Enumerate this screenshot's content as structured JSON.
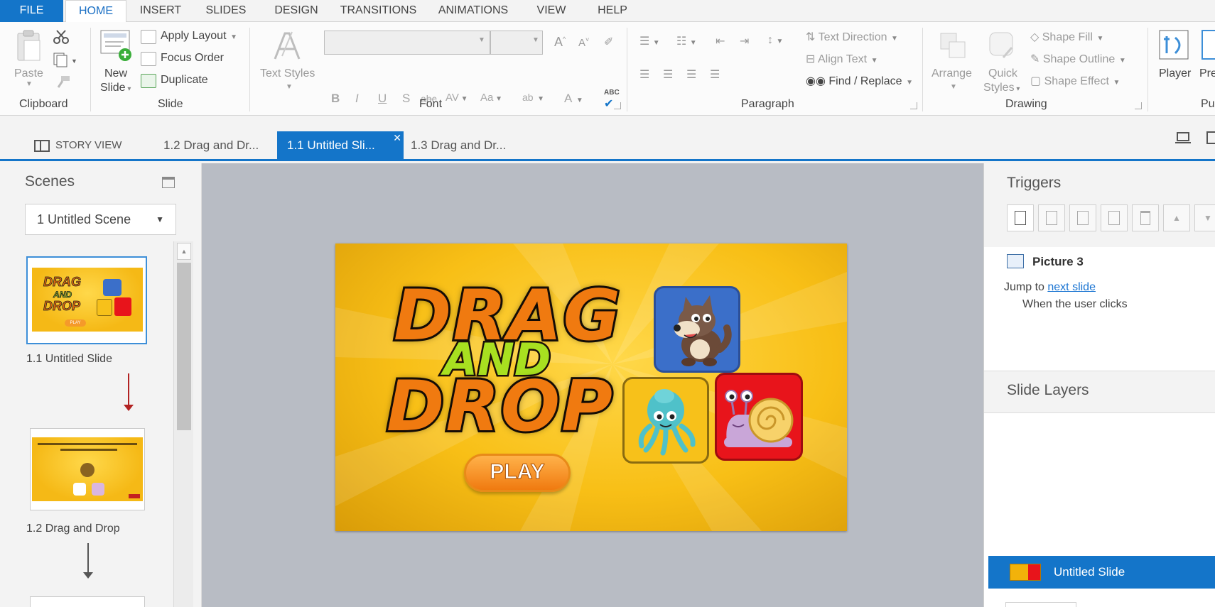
{
  "menu": [
    "FILE",
    "HOME",
    "INSERT",
    "SLIDES",
    "DESIGN",
    "TRANSITIONS",
    "ANIMATIONS",
    "VIEW",
    "HELP"
  ],
  "ribbon": {
    "clipboard": {
      "paste": "Paste",
      "label": "Clipboard"
    },
    "slide": {
      "new_slide_line1": "New",
      "new_slide_line2": "Slide",
      "apply_layout": "Apply Layout",
      "focus_order": "Focus Order",
      "duplicate": "Duplicate",
      "label": "Slide"
    },
    "text_styles": "Text Styles",
    "font": {
      "label": "Font",
      "bold": "B",
      "italic": "I",
      "underline": "U",
      "shadow": "S",
      "strike": "abc",
      "spacing": "AV",
      "case": "Aa",
      "highlight": "ab",
      "color": "A",
      "spell": "ABC"
    },
    "paragraph": {
      "text_direction": "Text Direction",
      "align_text": "Align Text",
      "find_replace": "Find / Replace",
      "label": "Paragraph"
    },
    "drawing": {
      "arrange": "Arrange",
      "quick_line1": "Quick",
      "quick_line2": "Styles",
      "shape_fill": "Shape Fill",
      "shape_outline": "Shape Outline",
      "shape_effect": "Shape Effect",
      "label": "Drawing"
    },
    "publish": {
      "player": "Player",
      "preview": "Pre",
      "label": "Pu"
    }
  },
  "tabs": {
    "story_view": "STORY VIEW",
    "tab1": "1.2 Drag and Dr...",
    "tab2": "1.1 Untitled Sli...",
    "tab3": "1.3 Drag and Dr..."
  },
  "scenes": {
    "title": "Scenes",
    "selected_scene": "1 Untitled Scene",
    "slides": [
      {
        "label": "1.1 Untitled Slide"
      },
      {
        "label": "1.2 Drag and Drop"
      }
    ]
  },
  "slide": {
    "title_line1": "DRAG",
    "title_line2": "AND",
    "title_line3": "DROP",
    "play": "PLAY",
    "thumb_play": "PLAY"
  },
  "triggers": {
    "title": "Triggers",
    "object": "Picture 3",
    "action_prefix": "Jump to",
    "action_link": "next slide",
    "condition": "When the user clicks"
  },
  "layers": {
    "title": "Slide Layers",
    "base_layer": "Untitled Slide"
  },
  "colors": {
    "accent": "#1475c9",
    "slide_yellow": "#f8bf16",
    "title_orange": "#f07a10",
    "and_green": "#a8e020",
    "tile_blue": "#3b6fc9",
    "tile_yellow": "#f7c11a",
    "tile_red": "#e8141b"
  }
}
